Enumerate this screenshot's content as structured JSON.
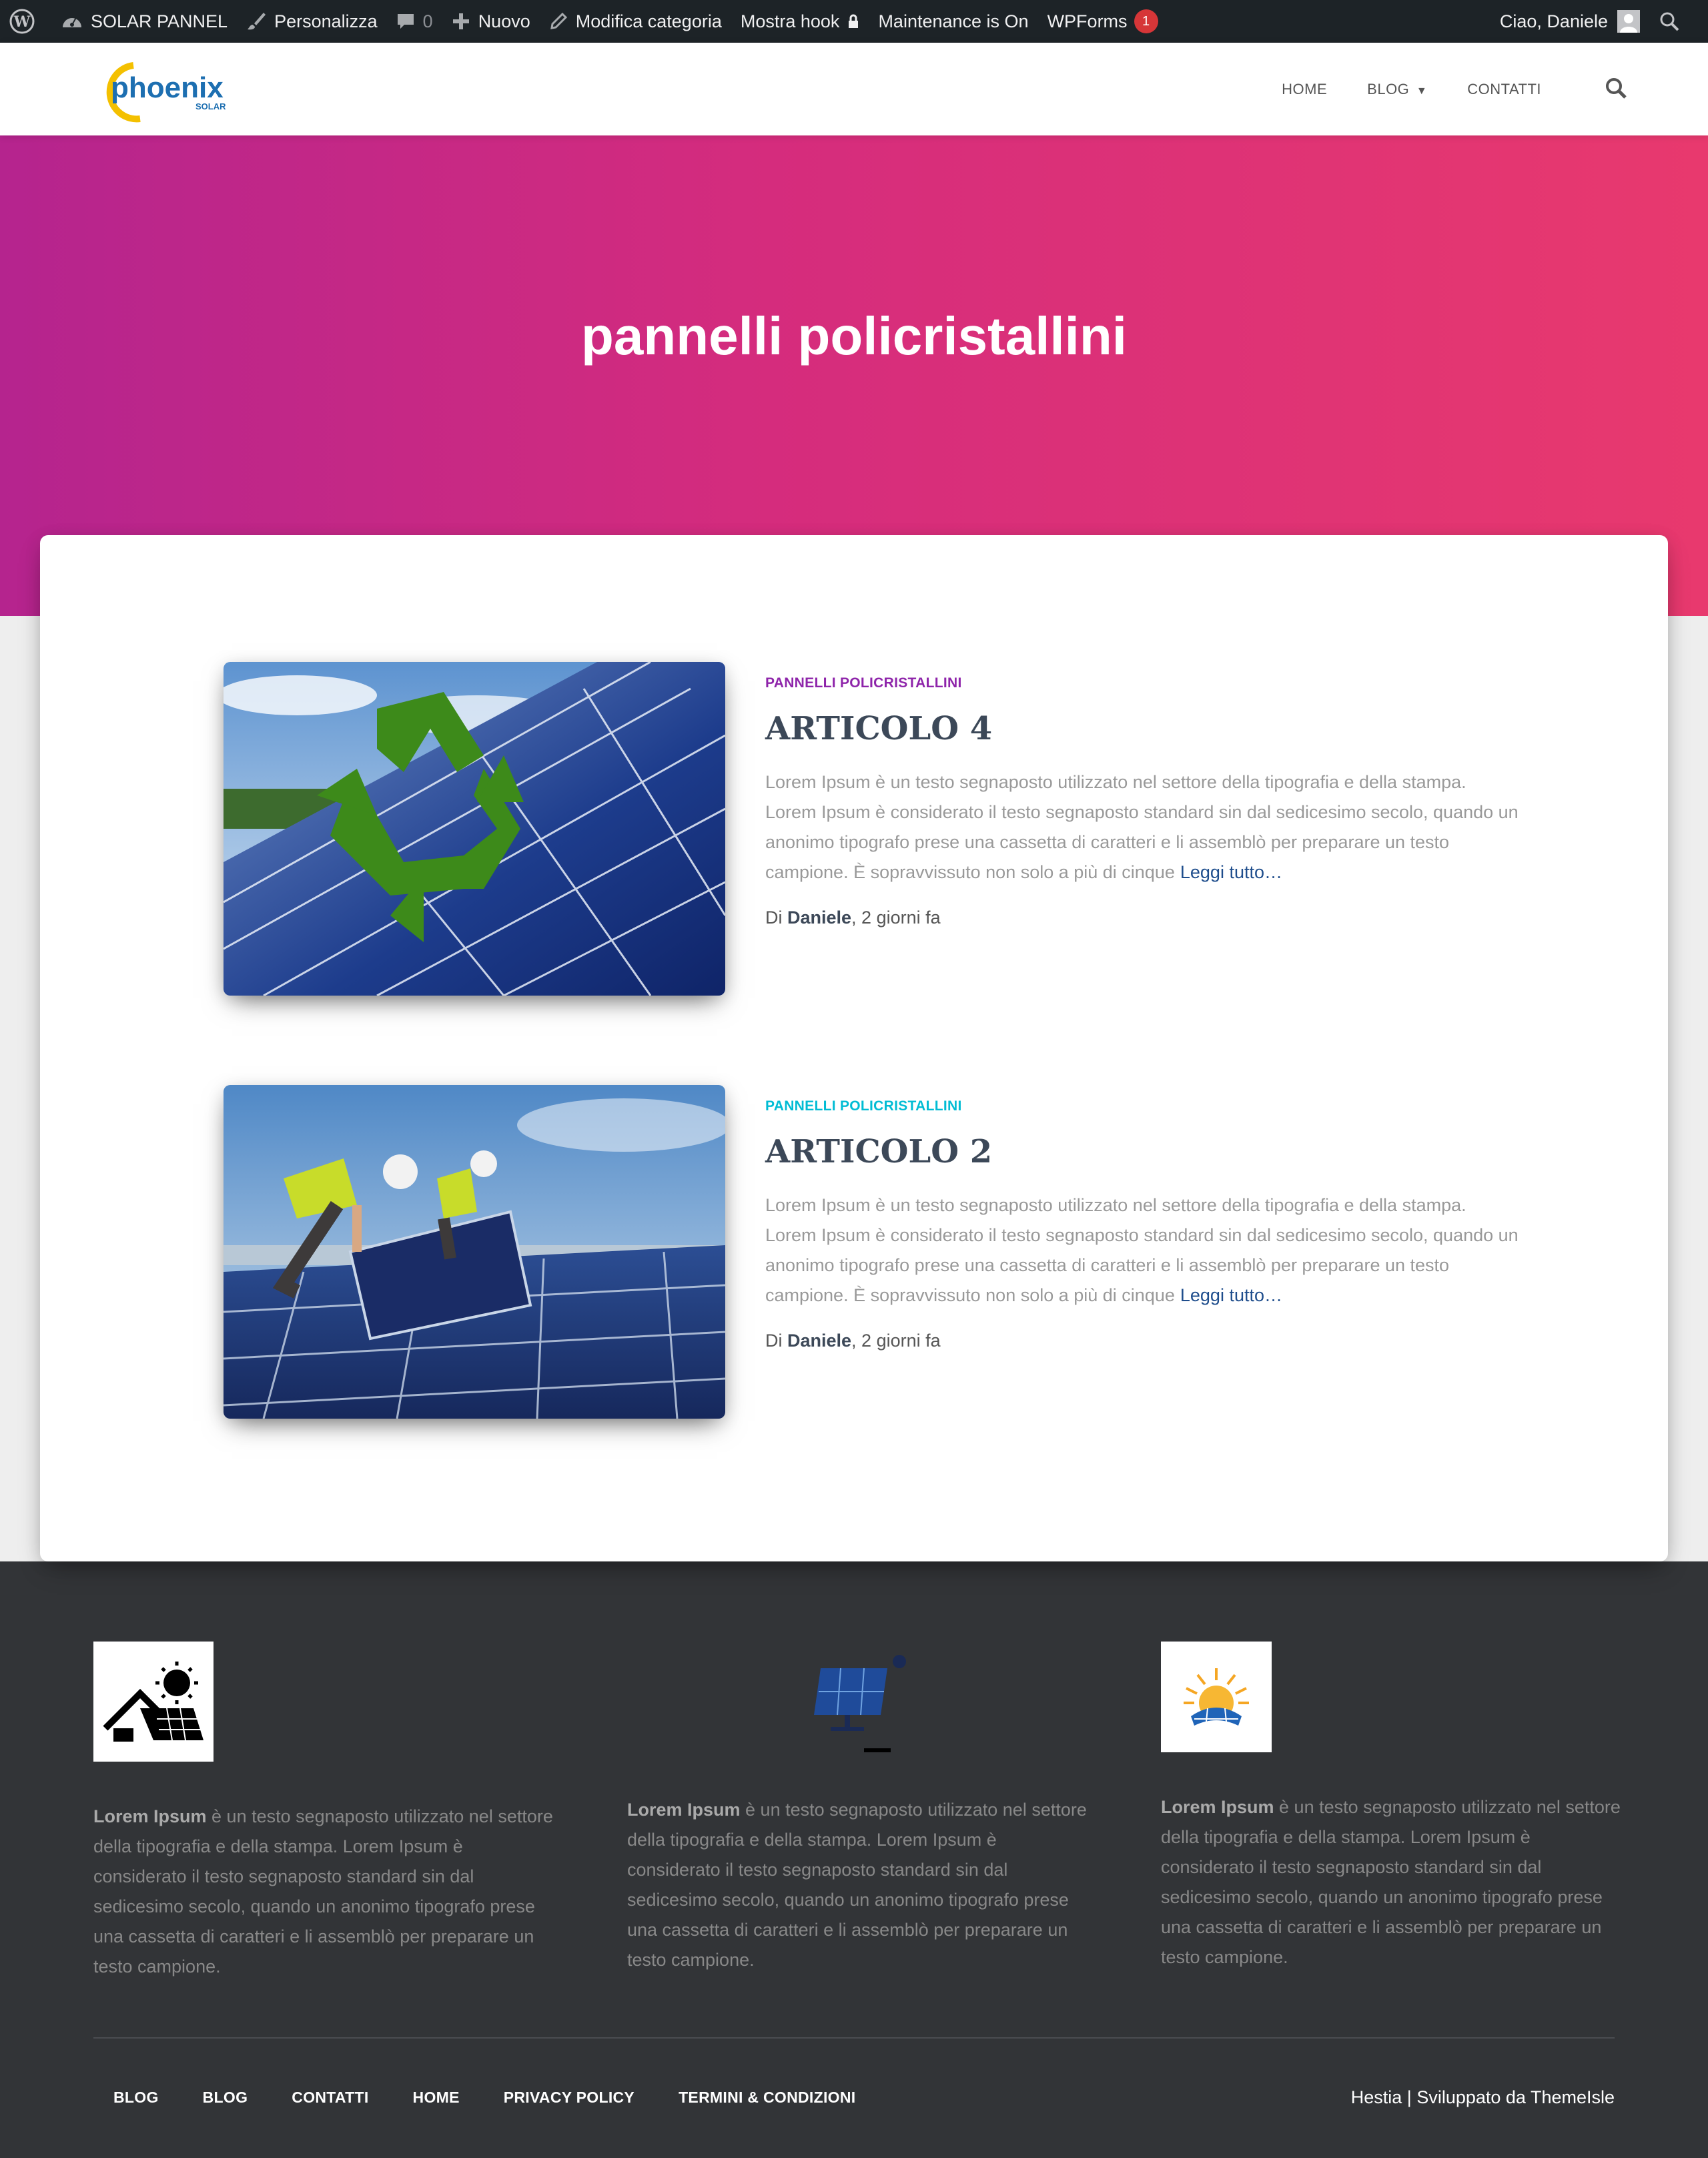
{
  "admin_bar": {
    "site_name": "SOLAR PANNEL",
    "customize": "Personalizza",
    "comments_count": "0",
    "new": "Nuovo",
    "edit_category": "Modifica categoria",
    "show_hook": "Mostra hook",
    "maintenance": "Maintenance is On",
    "wpforms": "WPForms",
    "wpforms_count": "1",
    "greeting": "Ciao, Daniele"
  },
  "header": {
    "logo_text": "phoenix",
    "logo_sub": "SOLAR",
    "nav": [
      "HOME",
      "BLOG",
      "CONTATTI"
    ]
  },
  "hero": {
    "title": "pannelli policristallini"
  },
  "posts": [
    {
      "category": "PANNELLI POLICRISTALLINI",
      "category_color": "#8e24aa",
      "title": "ARTICOLO 4",
      "excerpt": "Lorem Ipsum è un testo segnaposto utilizzato nel settore della tipografia e della stampa. Lorem Ipsum è considerato il testo segnaposto standard sin dal sedicesimo secolo, quando un anonimo tipografo prese una cassetta di caratteri e li assemblò per preparare un testo campione. È sopravvissuto non solo a più di cinque",
      "read_more": "Leggi tutto…",
      "meta_prefix": "Di ",
      "author": "Daniele",
      "date": ", 2 giorni fa"
    },
    {
      "category": "PANNELLI POLICRISTALLINI",
      "category_color": "#00bcd4",
      "title": "ARTICOLO 2",
      "excerpt": "Lorem Ipsum è un testo segnaposto utilizzato nel settore della tipografia e della stampa. Lorem Ipsum è considerato il testo segnaposto standard sin dal sedicesimo secolo, quando un anonimo tipografo prese una cassetta di caratteri e li assemblò per preparare un testo campione. È sopravvissuto non solo a più di cinque",
      "read_more": "Leggi tutto…",
      "meta_prefix": "Di ",
      "author": "Daniele",
      "date": ", 2 giorni fa"
    }
  ],
  "footer": {
    "columns": [
      {
        "bold": "Lorem Ipsum",
        "text": " è un testo segnaposto utilizzato nel settore della tipografia e della stampa. Lorem Ipsum è considerato il testo segnaposto standard sin dal sedicesimo secolo, quando un anonimo tipografo prese una cassetta di caratteri e li assemblò per preparare un testo campione."
      },
      {
        "bold": "Lorem Ipsum",
        "text": " è un testo segnaposto utilizzato nel settore della tipografia e della stampa. Lorem Ipsum è considerato il testo segnaposto standard sin dal sedicesimo secolo, quando un anonimo tipografo prese una cassetta di caratteri e li assemblò per preparare un testo campione."
      },
      {
        "bold": "Lorem Ipsum",
        "text": " è un testo segnaposto utilizzato nel settore della tipografia e della stampa. Lorem Ipsum è considerato il testo segnaposto standard sin dal sedicesimo secolo, quando un anonimo tipografo prese una cassetta di caratteri e li assemblò per preparare un testo campione."
      }
    ],
    "menu": [
      "BLOG",
      "BLOG",
      "CONTATTI",
      "HOME",
      "PRIVACY POLICY",
      "TERMINI & CONDIZIONI"
    ],
    "copyright": "Hestia | Sviluppato da ThemeIsle"
  }
}
